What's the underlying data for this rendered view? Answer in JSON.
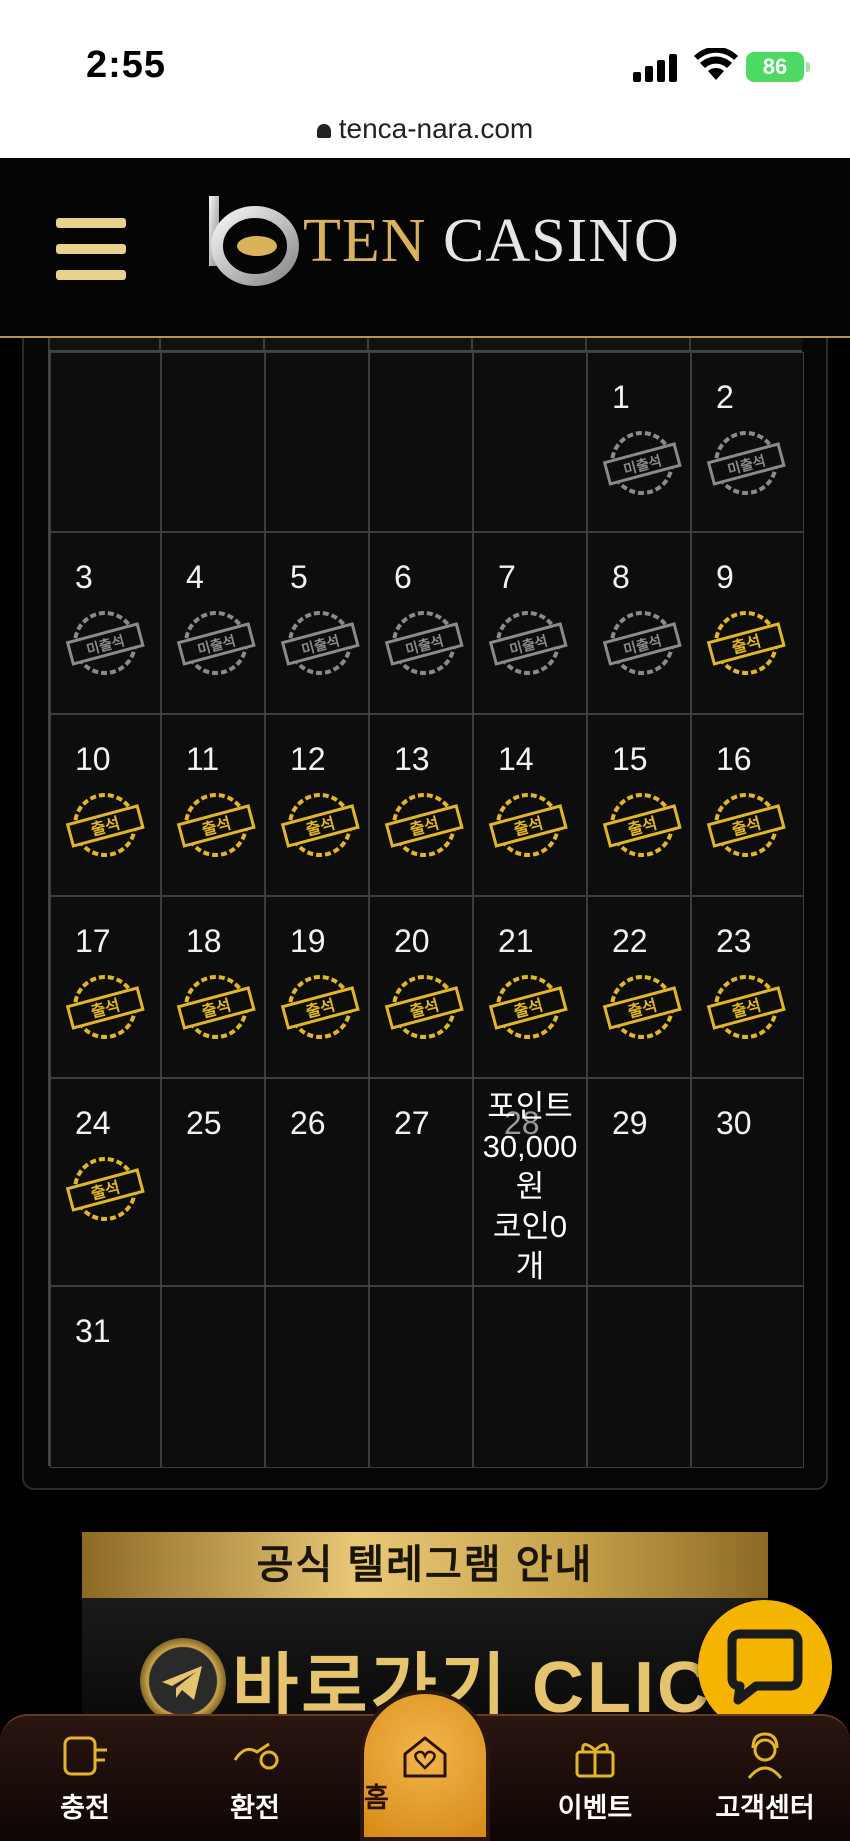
{
  "status_bar": {
    "time": "2:55",
    "battery": "86"
  },
  "browser": {
    "url": "tenca-nara.com"
  },
  "header": {
    "logo_ten": "TEN",
    "logo_casino": "CASINO"
  },
  "calendar": {
    "weeks": [
      [
        null,
        null,
        null,
        null,
        null,
        {
          "day": "1",
          "stamp": "미출석"
        },
        {
          "day": "2",
          "stamp": "미출석"
        }
      ],
      [
        {
          "day": "3",
          "stamp": "미출석"
        },
        {
          "day": "4",
          "stamp": "미출석"
        },
        {
          "day": "5",
          "stamp": "미출석"
        },
        {
          "day": "6",
          "stamp": "미출석"
        },
        {
          "day": "7",
          "stamp": "미출석"
        },
        {
          "day": "8",
          "stamp": "미출석"
        },
        {
          "day": "9",
          "stamp": "출석"
        }
      ],
      [
        {
          "day": "10",
          "stamp": "출석"
        },
        {
          "day": "11",
          "stamp": "출석"
        },
        {
          "day": "12",
          "stamp": "출석"
        },
        {
          "day": "13",
          "stamp": "출석"
        },
        {
          "day": "14",
          "stamp": "출석"
        },
        {
          "day": "15",
          "stamp": "출석"
        },
        {
          "day": "16",
          "stamp": "출석"
        }
      ],
      [
        {
          "day": "17",
          "stamp": "출석"
        },
        {
          "day": "18",
          "stamp": "출석"
        },
        {
          "day": "19",
          "stamp": "출석"
        },
        {
          "day": "20",
          "stamp": "출석"
        },
        {
          "day": "21",
          "stamp": "출석"
        },
        {
          "day": "22",
          "stamp": "출석"
        },
        {
          "day": "23",
          "stamp": "출석"
        }
      ],
      [
        {
          "day": "24",
          "stamp": "출석"
        },
        {
          "day": "25"
        },
        {
          "day": "26"
        },
        {
          "day": "27"
        },
        {
          "day": "28",
          "reward": [
            "포인트",
            "30,000",
            "원",
            "코인0",
            "개"
          ]
        },
        {
          "day": "29"
        },
        {
          "day": "30"
        }
      ],
      [
        {
          "day": "31"
        },
        null,
        null,
        null,
        null,
        null,
        null
      ]
    ]
  },
  "banner": {
    "title": "공식 텔레그램 안내",
    "cta": "바로가기 CLICK"
  },
  "nav": {
    "charge": "충전",
    "exchange": "환전",
    "home": "홈",
    "event": "이벤트",
    "support": "고객센터"
  },
  "colors": {
    "gold": "#d9b35b",
    "stamp_attended": "#e2b629",
    "stamp_absent": "#8a8a8a",
    "chat": "#f5b400"
  }
}
